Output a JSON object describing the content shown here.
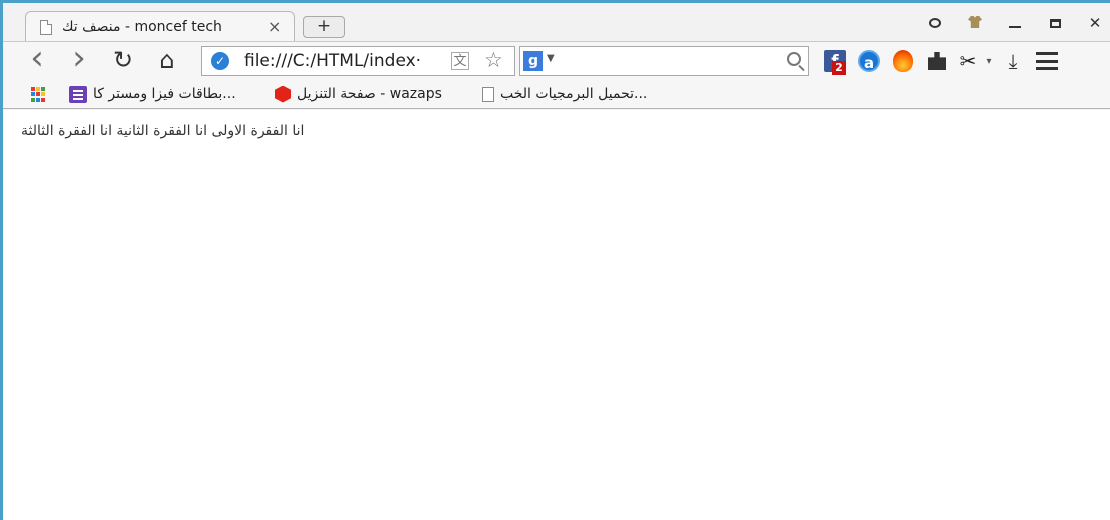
{
  "tab": {
    "title": "منصف تك - moncef tech",
    "close_symbol": "×",
    "new_tab_symbol": "+"
  },
  "toolbar": {
    "back_symbol": "‹",
    "forward_symbol": "›",
    "reload_symbol": "↻",
    "home_symbol": "⌂",
    "url": "file:///C:/HTML/index·",
    "search_value": "",
    "extensions": {
      "facebook_badge": "2"
    }
  },
  "bookmarks": [
    {
      "label": "بطاقات فيزا ومستر كا...",
      "icon": "list-icon"
    },
    {
      "label": "صفحة التنزيل - wazaps",
      "icon": "hex-icon"
    },
    {
      "label": "تحميل البرمجيات الخب...",
      "icon": "page-icon"
    }
  ],
  "content": {
    "paragraph": "انا الفقرة الاولى انا الفقرة الثانية انا الفقرة الثالثة"
  },
  "colors": {
    "window_border": "#4aa0c9",
    "facebook": "#3b5998",
    "badge": "#cc1111"
  }
}
